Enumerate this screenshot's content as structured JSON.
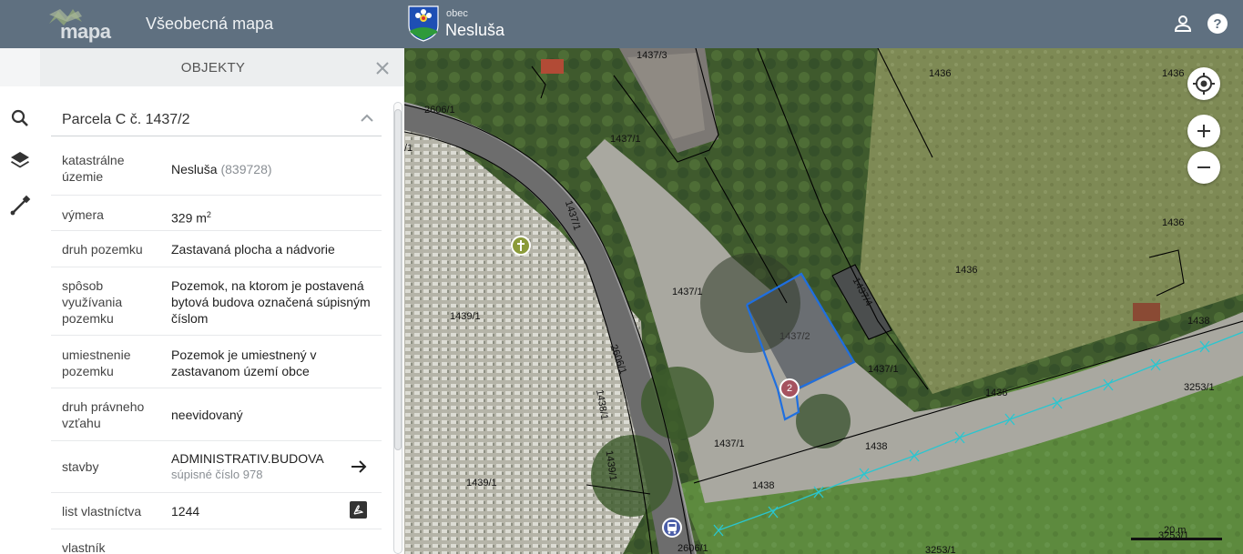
{
  "header": {
    "logo_text": "mapa",
    "app_title": "Všeobecná mapa",
    "municipality_label": "obec",
    "municipality_name": "Nesluša"
  },
  "panel": {
    "title": "OBJEKTY",
    "parcel_title": "Parcela C č. 1437/2",
    "rows": [
      {
        "label": "katastrálne územie",
        "value": "Nesluša",
        "value_extra": "(839728)"
      },
      {
        "label": "výmera",
        "value": "329 m",
        "value_sup": "2"
      },
      {
        "label": "druh pozemku",
        "value": "Zastavaná plocha a nádvorie"
      },
      {
        "label": "spôsob využívania pozemku",
        "value": "Pozemok, na ktorom je postavená bytová budova označená súpisným číslom"
      },
      {
        "label": "umiestnenie pozemku",
        "value": "Pozemok je umiestnený v zastavanom území obce"
      },
      {
        "label": "druh právneho vzťahu",
        "value": "neevidovaný"
      },
      {
        "label": "stavby",
        "value": "ADMINISTRATIV.BUDOVA",
        "value_sub": "súpisné číslo 978"
      },
      {
        "label": "list vlastníctva",
        "value": "1244"
      },
      {
        "label": "vlastník",
        "value": ""
      }
    ]
  },
  "map": {
    "labels": [
      "1437/3",
      "1437/1",
      "2606/1",
      "1436",
      "1436",
      "1436",
      "1436",
      "1437/1",
      "1437/4",
      "1437/2",
      "1437/1",
      "1437/1",
      "1439/1",
      "2606/1",
      "1438/1",
      "1439/1",
      "1439/1",
      "1438",
      "1438",
      "1438",
      "1438",
      "3253/1",
      "3253/1",
      "3253/1",
      "2606/1",
      "1437/1",
      "/1"
    ],
    "marker_number": "2",
    "scale_label": "20 m"
  },
  "colors": {
    "header_bg": "#5f7080",
    "selection_outline": "#1f6fe0",
    "utility_line": "#29c6d0"
  }
}
